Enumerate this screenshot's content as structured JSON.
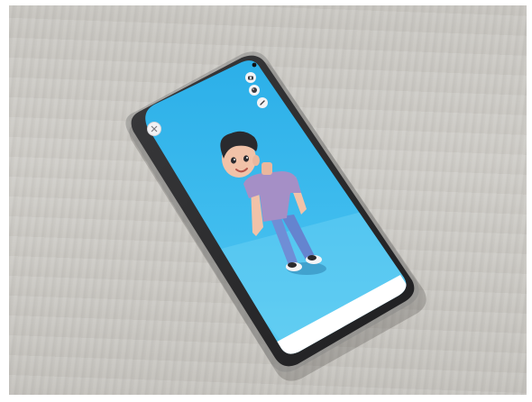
{
  "scene": {
    "description_colors": {
      "desk": "#cbc9c4",
      "phone_frame": "#2b2b2d",
      "screen_sky_top": "#2fb2ea",
      "screen_sky_bottom": "#52c7f0",
      "bottom_bar": "#ffffff"
    }
  },
  "screen": {
    "top_right_icons": [
      {
        "name": "camera-icon"
      },
      {
        "name": "palette-icon"
      },
      {
        "name": "edit-pencil-icon"
      }
    ],
    "top_left_icon": {
      "name": "close-icon"
    }
  },
  "avatar": {
    "shirt_color": "#a58fc6",
    "pants_color": "#6f8ed6",
    "hair_color": "#2a2a2e",
    "skin_color": "#f1c2a8"
  }
}
